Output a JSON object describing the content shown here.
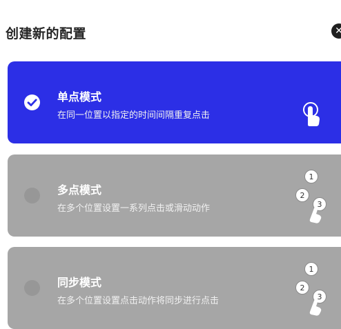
{
  "dialog": {
    "title": "创建新的配置",
    "close_icon": "close-icon"
  },
  "options": [
    {
      "title": "单点模式",
      "description": "在同一位置以指定的时间间隔重复点击",
      "selected": true,
      "icon": "single-tap-icon"
    },
    {
      "title": "多点模式",
      "description": "在多个位置设置一系列点击或滑动动作",
      "selected": false,
      "icon": "multi-tap-icon",
      "icon_numbers": [
        "1",
        "2",
        "3"
      ]
    },
    {
      "title": "同步模式",
      "description": "在多个位置设置点击动作将同步进行点击",
      "selected": false,
      "icon": "sync-tap-icon",
      "icon_numbers": [
        "1",
        "2",
        "3"
      ]
    }
  ],
  "colors": {
    "selected_card": "#2c2fe6",
    "unselected_card": "#a6a6a6",
    "title_text": "#262626"
  }
}
